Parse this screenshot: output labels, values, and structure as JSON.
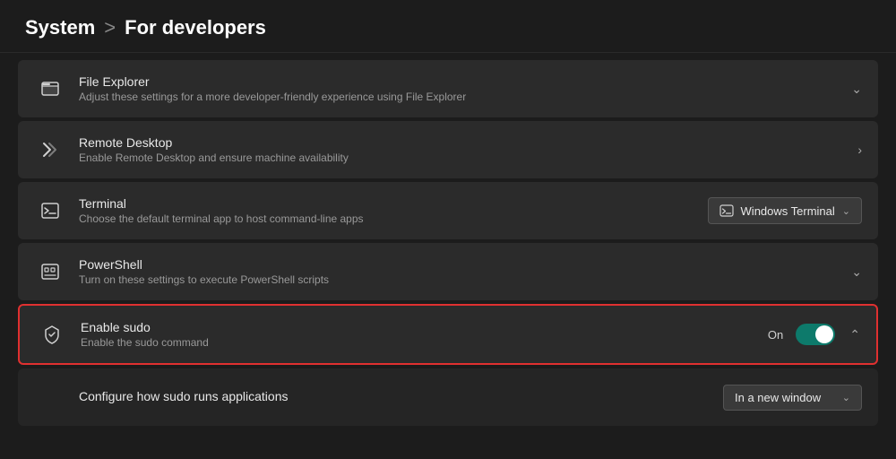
{
  "header": {
    "system_label": "System",
    "separator": ">",
    "page_title": "For developers"
  },
  "settings": [
    {
      "id": "file-explorer",
      "icon": "🗂",
      "icon_name": "file-explorer-icon",
      "title": "File Explorer",
      "desc": "Adjust these settings for a more developer-friendly experience using File Explorer",
      "control": "chevron-down",
      "highlighted": false
    },
    {
      "id": "remote-desktop",
      "icon": "≫",
      "icon_name": "remote-desktop-icon",
      "title": "Remote Desktop",
      "desc": "Enable Remote Desktop and ensure machine availability",
      "control": "chevron-right",
      "highlighted": false
    },
    {
      "id": "terminal",
      "icon": "⊞",
      "icon_name": "terminal-icon",
      "title": "Terminal",
      "desc": "Choose the default terminal app to host command-line apps",
      "control": "dropdown",
      "dropdown_value": "Windows Terminal",
      "highlighted": false
    },
    {
      "id": "powershell",
      "icon": "⊡",
      "icon_name": "powershell-icon",
      "title": "PowerShell",
      "desc": "Turn on these settings to execute PowerShell scripts",
      "control": "chevron-down",
      "highlighted": false
    },
    {
      "id": "enable-sudo",
      "icon": "🛡",
      "icon_name": "sudo-icon",
      "title": "Enable sudo",
      "desc": "Enable the sudo command",
      "control": "toggle-chevron-up",
      "toggle_state": "On",
      "highlighted": true
    }
  ],
  "sub_settings": [
    {
      "id": "configure-sudo",
      "title": "Configure how sudo runs applications",
      "control": "dropdown",
      "dropdown_value": "In a new window"
    }
  ],
  "controls": {
    "chevron_down": "∨",
    "chevron_right": "›",
    "chevron_up": "∧",
    "dropdown_arrow": "∨",
    "terminal_icon": "⊞",
    "toggle_on_label": "On"
  }
}
